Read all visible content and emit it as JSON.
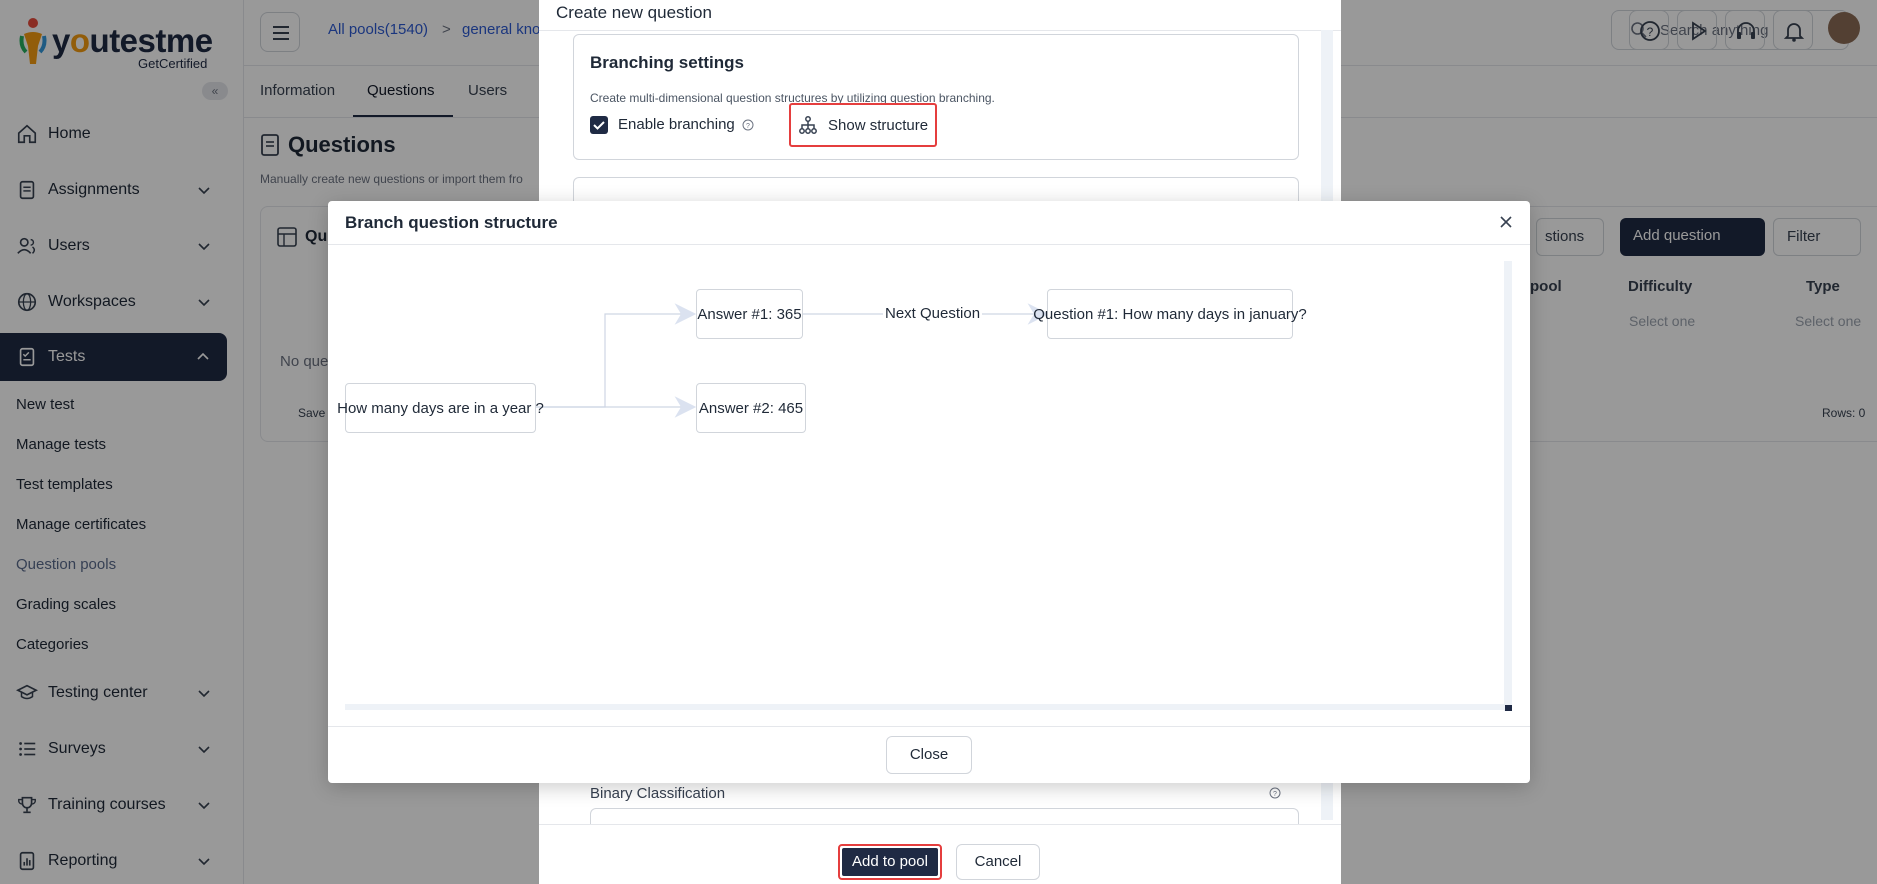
{
  "app": {
    "logo_text_a": "y",
    "logo_text_b": "utestme",
    "logo_sub": "GetCertified"
  },
  "sidebar": {
    "items": [
      {
        "label": "Home",
        "icon": "home-icon"
      },
      {
        "label": "Assignments",
        "icon": "document-icon"
      },
      {
        "label": "Users",
        "icon": "users-icon"
      },
      {
        "label": "Workspaces",
        "icon": "globe-icon"
      },
      {
        "label": "Tests",
        "icon": "test-icon"
      },
      {
        "label": "Testing center",
        "icon": "graduation-cap-icon"
      },
      {
        "label": "Surveys",
        "icon": "list-icon"
      },
      {
        "label": "Training courses",
        "icon": "trophy-icon"
      },
      {
        "label": "Reporting",
        "icon": "report-icon"
      }
    ],
    "subitems": [
      "New test",
      "Manage tests",
      "Test templates",
      "Manage certificates",
      "Question pools",
      "Grading scales",
      "Categories"
    ]
  },
  "header": {
    "breadcrumb_1": "All pools(1540)",
    "breadcrumb_sep": ">",
    "breadcrumb_2": "general kno",
    "search_placeholder": "Search anything"
  },
  "main": {
    "tabs": [
      "Information",
      "Questions",
      "Users"
    ],
    "title": "Questions",
    "description": "Manually create new questions or import them fro",
    "grid_title": "Qu",
    "no_questions": "No que",
    "save": "Save",
    "questions_dropdown": "stions",
    "add_question": "Add question",
    "filter": "Filter",
    "columns": [
      "pool",
      "Difficulty",
      "Type"
    ],
    "select_one": "Select one",
    "rows": "Rows: 0"
  },
  "create_question": {
    "title": "Create new question",
    "branching_title": "Branching settings",
    "branching_desc": "Create multi-dimensional question structures by utilizing question branching.",
    "enable_branching": "Enable branching",
    "show_structure": "Show structure",
    "binary_classification": "Binary Classification",
    "add_to_pool": "Add to pool",
    "cancel": "Cancel"
  },
  "modal": {
    "title": "Branch question structure",
    "close": "Close",
    "nodes": {
      "root": "How many days are in a year ?",
      "answer1": "Answer #1: 365",
      "answer2": "Answer #2: 465",
      "next": "Question #1: How many days in january?"
    },
    "edge_label": "Next Question"
  },
  "colors": {
    "primary": "#1f2a44",
    "highlight": "#e53e3e",
    "link": "#2d5bd3"
  }
}
